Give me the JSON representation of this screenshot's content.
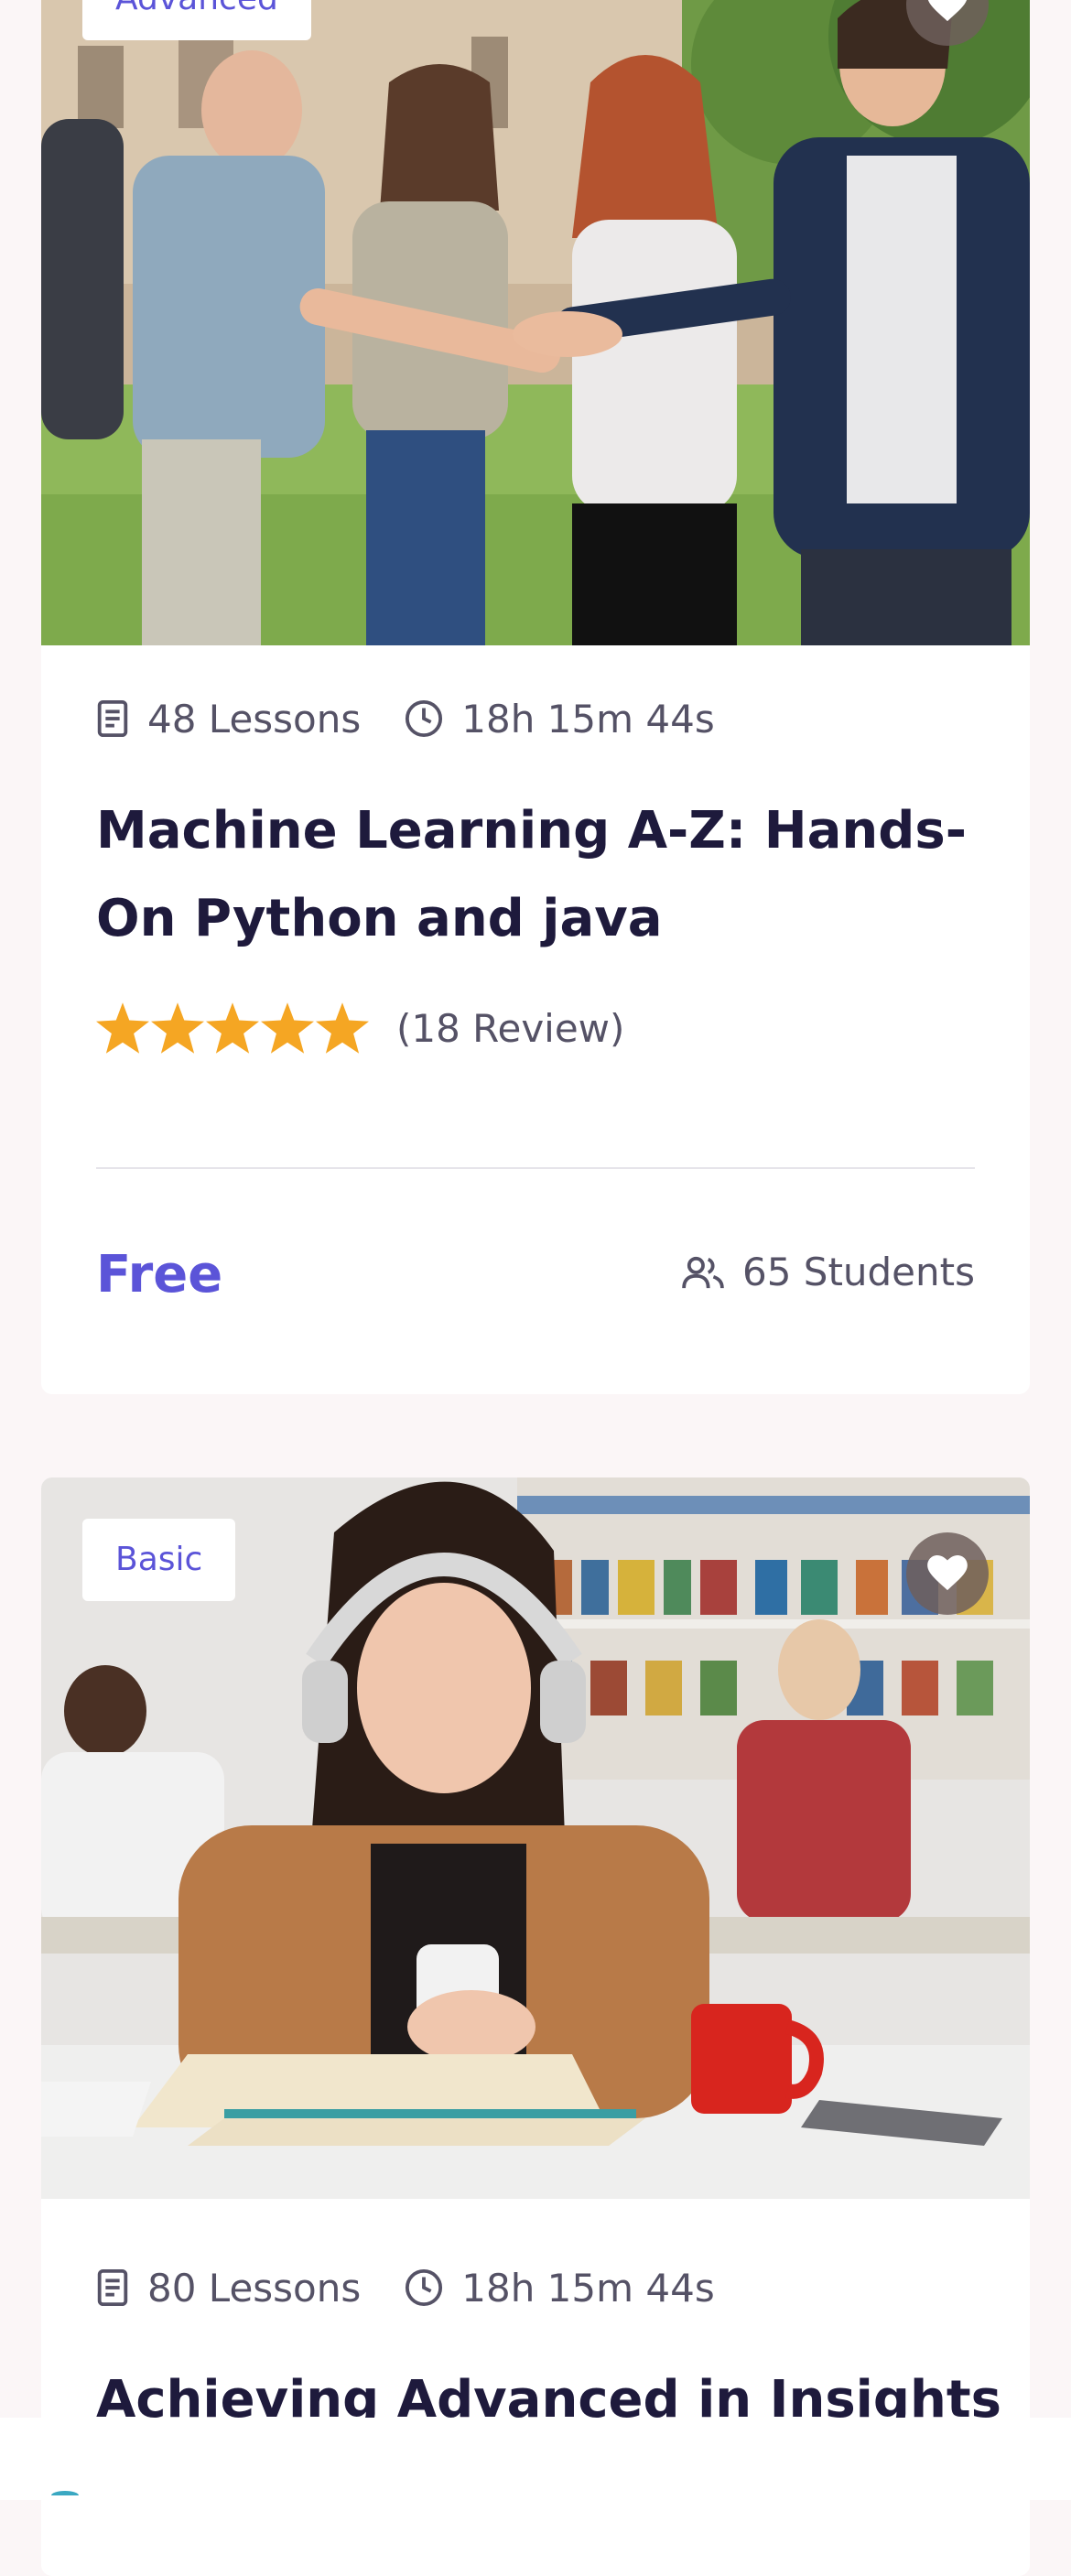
{
  "courses": [
    {
      "level": "Advanced",
      "lessons": "48 Lessons",
      "duration": "18h 15m 44s",
      "title": "Machine Learning A-Z: Hands-On Python and java",
      "rating": 5,
      "reviews": "(18 Review)",
      "price": "Free",
      "students": "65 Students",
      "image": "students-stacking-hands-photo"
    },
    {
      "level": "Basic",
      "lessons": "80 Lessons",
      "duration": "18h 15m 44s",
      "title": "Achieving Advanced in Insights",
      "image": "student-with-headphones-in-library-photo"
    }
  ],
  "colors": {
    "accent": "#5b54d8",
    "star": "#f5a623",
    "title": "#1e1a3c",
    "muted": "#555266",
    "background": "#fbf6f7"
  },
  "icons": [
    "book-icon",
    "clock-icon",
    "heart-icon",
    "star-icon",
    "users-icon"
  ]
}
